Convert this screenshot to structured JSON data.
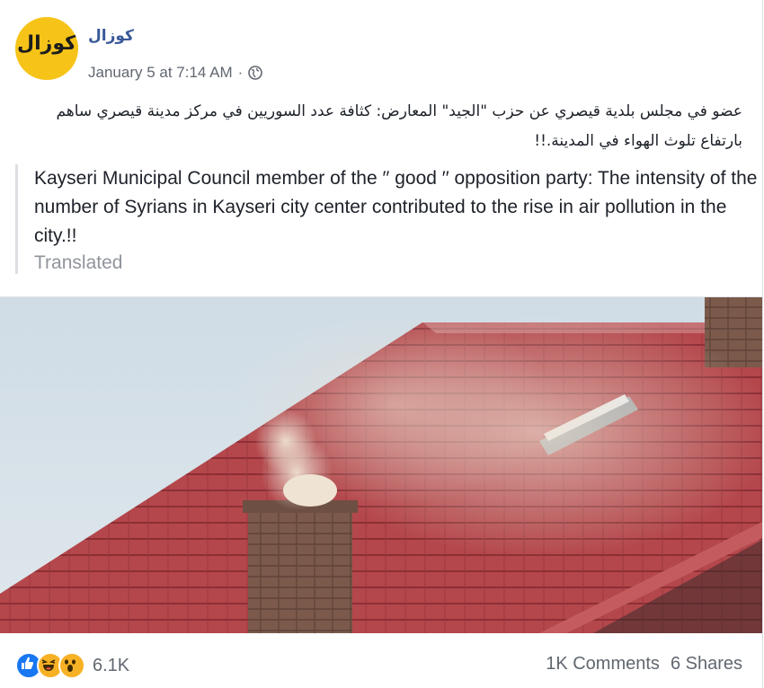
{
  "post": {
    "page_name": "كوزال",
    "avatar_text": "كوزال",
    "date": "January 5 at 7:14 AM",
    "separator": "·",
    "arabic_text": "عضو في مجلس بلدية قيصري عن حزب \"الجيد\" المعارض: كثافة عدد السوريين في مركز مدينة قيصري ساهم بارتفاع تلوث الهواء في المدينة.!!",
    "translation_text": "Kayseri Municipal Council member of the ′′ good ′′ opposition party: The intensity of the number of Syrians in Kayseri city center contributed to the rise in air pollution in the city.!!",
    "translated_label": "Translated"
  },
  "footer": {
    "reaction_count": "6.1K",
    "comments": "1K Comments",
    "shares": "6 Shares",
    "reaction_icons": [
      "like-icon",
      "haha-icon",
      "wow-icon"
    ]
  },
  "colors": {
    "link": "#385898",
    "meta_text": "#616770",
    "like_blue": "#1877f2",
    "emoji_yellow": "#f7b125",
    "avatar_yellow": "#f6c318"
  }
}
